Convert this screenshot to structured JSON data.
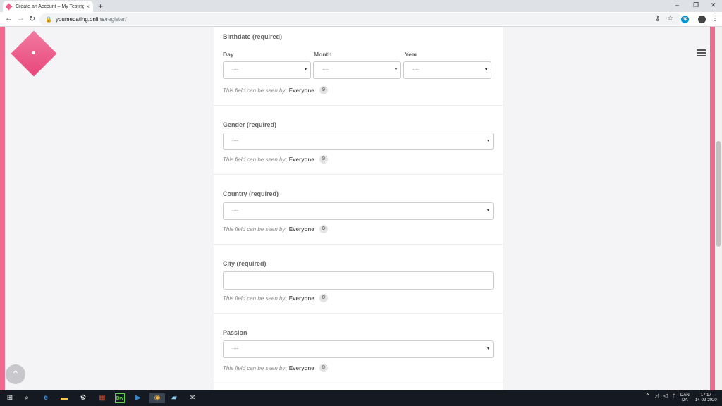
{
  "browser": {
    "tab_title": "Create an Account – My Testing",
    "url_domain": "youmedating.online",
    "url_path": "/register/"
  },
  "form": {
    "birthdate": {
      "label": "Birthdate (required)",
      "day_label": "Day",
      "month_label": "Month",
      "year_label": "Year",
      "day_value": "----",
      "month_value": "----",
      "year_value": "----"
    },
    "gender": {
      "label": "Gender (required)",
      "value": "----"
    },
    "country": {
      "label": "Country (required)",
      "value": "----"
    },
    "city": {
      "label": "City (required)",
      "value": ""
    },
    "passion": {
      "label": "Passion",
      "value": "----"
    },
    "visibility": {
      "prefix": "This field can be seen by:",
      "value": "Everyone"
    }
  },
  "taskbar": {
    "lang_top": "DAN",
    "lang_bottom": "DA",
    "time": "17:17",
    "date": "14-02-2020"
  },
  "colors": {
    "accent": "#ef6a8f",
    "logo": "#e9457a"
  },
  "icons": {
    "tab_close": "×",
    "new_tab": "+",
    "back": "←",
    "forward": "→",
    "reload": "↻",
    "lock": "🔒",
    "key": "⚷",
    "star": "☆",
    "menu": "⋮",
    "win_min": "–",
    "win_restore": "❐",
    "win_close": "✕",
    "dropdown_arrow": "▾",
    "gear": "⚙",
    "scroll_top": "⌃",
    "windows": "⊞",
    "search": "⌕",
    "edge": "e",
    "folder": "▬",
    "settings": "⚙",
    "dreamweaver": "Dw",
    "chrome": "◉",
    "mail": "✉"
  }
}
